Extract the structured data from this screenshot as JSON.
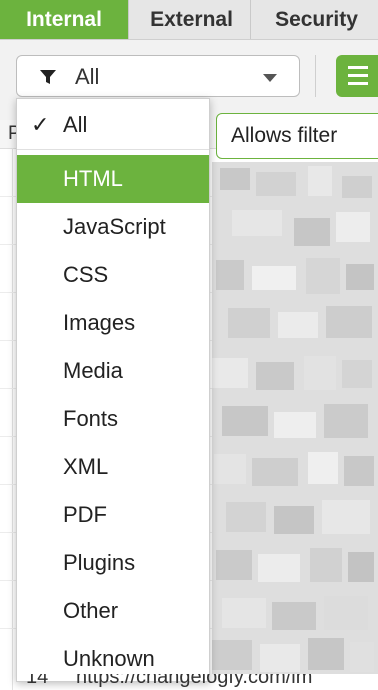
{
  "tabs": [
    {
      "label": "Internal",
      "active": true
    },
    {
      "label": "External",
      "active": false
    },
    {
      "label": "Security",
      "active": false
    }
  ],
  "filter": {
    "selected": "All",
    "icon": "funnel-icon"
  },
  "table": {
    "column_header_partial": "P",
    "bottom_row": {
      "number": "14",
      "url": "https://changelogfy.com/im"
    }
  },
  "tooltip": {
    "text": "Allows filter"
  },
  "dropdown": {
    "items": [
      {
        "label": "All",
        "checked": true
      },
      {
        "label": "HTML",
        "highlighted": true
      },
      {
        "label": "JavaScript"
      },
      {
        "label": "CSS"
      },
      {
        "label": "Images"
      },
      {
        "label": "Media"
      },
      {
        "label": "Fonts"
      },
      {
        "label": "XML"
      },
      {
        "label": "PDF"
      },
      {
        "label": "Plugins"
      },
      {
        "label": "Other"
      },
      {
        "label": "Unknown"
      }
    ]
  },
  "colors": {
    "accent": "#6cb33e"
  }
}
